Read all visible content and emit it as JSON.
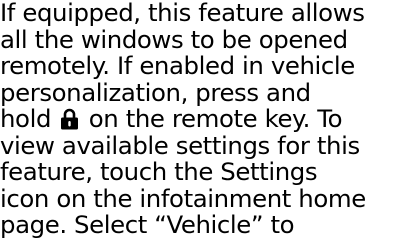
{
  "document": {
    "lines": [
      "If equipped, this feature allows",
      "all the windows to be opened",
      "remotely. If enabled in vehicle",
      "personalization, press and",
      {
        "before": "hold",
        "icon": "lock-icon",
        "after": "on the remote key. To"
      },
      "view available settings for this",
      "feature, touch the Settings",
      "icon on the infotainment home",
      "page. Select “Vehicle” to"
    ]
  }
}
